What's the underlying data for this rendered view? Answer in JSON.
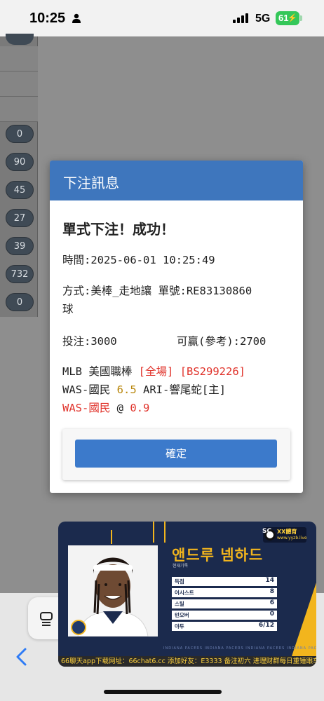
{
  "status_bar": {
    "time": "10:25",
    "network": "5G",
    "battery": "61"
  },
  "background": {
    "column_values": [
      "0",
      "90",
      "45",
      "27",
      "39",
      "732",
      "0"
    ]
  },
  "dialog": {
    "title": "下注訊息",
    "headline": "單式下注！成功！",
    "time_line": "時間:2025-06-01 10:25:49",
    "method_line_1": "方式:美棒_走地讓  單號:RE83130860",
    "method_line_2": "球",
    "stake": "投注:3000",
    "win": "可贏(參考):2700",
    "league": "MLB 美國職棒",
    "scope": "[全場]",
    "ticket": "[BS299226]",
    "home_team": "WAS-國民",
    "handicap": "6.5",
    "away_team": "ARI-響尾蛇[主]",
    "pick": "WAS-國民",
    "at": "@",
    "odds": "0.9",
    "confirm_label": "確定"
  },
  "ad": {
    "player_name": "앤드루 넴하드",
    "player_sub": "현재기록",
    "logo_text": "XX體育",
    "logo_url": "www.yyzb.live",
    "sc_label": "SC",
    "stats": [
      {
        "label": "득점",
        "value": "14"
      },
      {
        "label": "어시스트",
        "value": "8"
      },
      {
        "label": "스틸",
        "value": "6"
      },
      {
        "label": "턴오버",
        "value": "0"
      },
      {
        "label": "야투",
        "value": "6/12"
      }
    ],
    "team_strip": "INDIANA PACERS    INDIANA PACERS    INDIANA PACERS    INDIANA PACERS",
    "banner": "66聊天app下载网址：66chat6.cc   添加好友：E3333   备注初六 进理财群每日重锤跟车！"
  },
  "colors": {
    "header_blue": "#3e76bd",
    "button_blue": "#3c7acb",
    "red": "#e0322a",
    "gold": "#b8860b"
  }
}
